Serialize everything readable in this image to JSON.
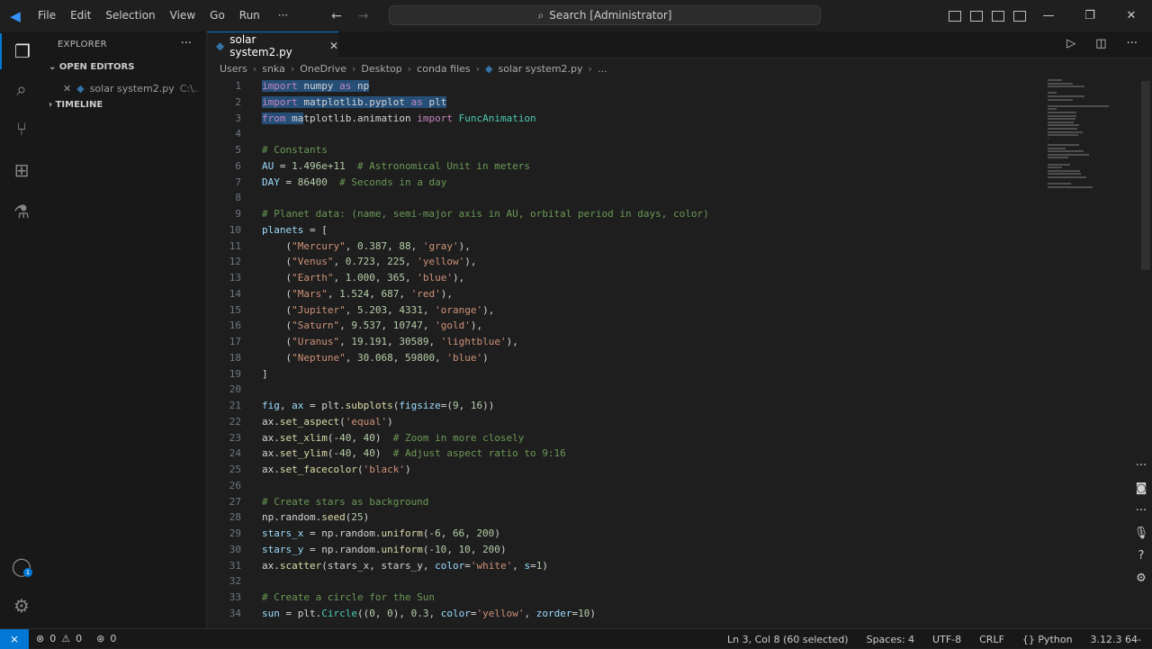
{
  "menu": [
    "File",
    "Edit",
    "Selection",
    "View",
    "Go",
    "Run"
  ],
  "menu_more": "···",
  "search": {
    "text": "Search [Administrator]"
  },
  "explorer": {
    "title": "EXPLORER",
    "more": "···",
    "open_editors": "OPEN EDITORS",
    "open_file": "solar system2.py",
    "open_file_path": "C:\\...",
    "timeline": "TIMELINE"
  },
  "tab": {
    "label": "solar system2.py"
  },
  "breadcrumb": [
    "Users",
    "snka",
    "OneDrive",
    "Desktop",
    "conda files",
    "solar system2.py",
    "..."
  ],
  "code_lines": [
    {
      "n": "1",
      "parts": [
        [
          "kw sel",
          "import"
        ],
        [
          "pl sel",
          " numpy "
        ],
        [
          "kw sel",
          "as"
        ],
        [
          "pl sel",
          " np"
        ]
      ]
    },
    {
      "n": "2",
      "parts": [
        [
          "kw sel",
          "import"
        ],
        [
          "pl sel",
          " matplotlib.pyplot "
        ],
        [
          "kw sel",
          "as"
        ],
        [
          "pl sel",
          " plt"
        ]
      ]
    },
    {
      "n": "3",
      "parts": [
        [
          "kw sel",
          "from"
        ],
        [
          "pl sel",
          " ma"
        ],
        [
          "pl",
          "tplotlib.animation "
        ],
        [
          "kw",
          "import"
        ],
        [
          "cl",
          " FuncAnimation"
        ]
      ]
    },
    {
      "n": "4",
      "parts": []
    },
    {
      "n": "5",
      "parts": [
        [
          "cm",
          "# Constants"
        ]
      ]
    },
    {
      "n": "6",
      "parts": [
        [
          "vr",
          "AU"
        ],
        [
          "pl",
          " = "
        ],
        [
          "nu",
          "1.496e+11"
        ],
        [
          "cm",
          "  # Astronomical Unit in meters"
        ]
      ]
    },
    {
      "n": "7",
      "parts": [
        [
          "vr",
          "DAY"
        ],
        [
          "pl",
          " = "
        ],
        [
          "nu",
          "86400"
        ],
        [
          "cm",
          "  # Seconds in a day"
        ]
      ]
    },
    {
      "n": "8",
      "parts": []
    },
    {
      "n": "9",
      "parts": [
        [
          "cm",
          "# Planet data: (name, semi-major axis in AU, orbital period in days, color)"
        ]
      ]
    },
    {
      "n": "10",
      "parts": [
        [
          "vr",
          "planets"
        ],
        [
          "pl",
          " = ["
        ]
      ]
    },
    {
      "n": "11",
      "parts": [
        [
          "pl",
          "    ("
        ],
        [
          "st",
          "\"Mercury\""
        ],
        [
          "pl",
          ", "
        ],
        [
          "nu",
          "0.387"
        ],
        [
          "pl",
          ", "
        ],
        [
          "nu",
          "88"
        ],
        [
          "pl",
          ", "
        ],
        [
          "st",
          "'gray'"
        ],
        [
          "pl",
          "),"
        ]
      ]
    },
    {
      "n": "12",
      "parts": [
        [
          "pl",
          "    ("
        ],
        [
          "st",
          "\"Venus\""
        ],
        [
          "pl",
          ", "
        ],
        [
          "nu",
          "0.723"
        ],
        [
          "pl",
          ", "
        ],
        [
          "nu",
          "225"
        ],
        [
          "pl",
          ", "
        ],
        [
          "st",
          "'yellow'"
        ],
        [
          "pl",
          "),"
        ]
      ]
    },
    {
      "n": "13",
      "parts": [
        [
          "pl",
          "    ("
        ],
        [
          "st",
          "\"Earth\""
        ],
        [
          "pl",
          ", "
        ],
        [
          "nu",
          "1.000"
        ],
        [
          "pl",
          ", "
        ],
        [
          "nu",
          "365"
        ],
        [
          "pl",
          ", "
        ],
        [
          "st",
          "'blue'"
        ],
        [
          "pl",
          "),"
        ]
      ]
    },
    {
      "n": "14",
      "parts": [
        [
          "pl",
          "    ("
        ],
        [
          "st",
          "\"Mars\""
        ],
        [
          "pl",
          ", "
        ],
        [
          "nu",
          "1.524"
        ],
        [
          "pl",
          ", "
        ],
        [
          "nu",
          "687"
        ],
        [
          "pl",
          ", "
        ],
        [
          "st",
          "'red'"
        ],
        [
          "pl",
          "),"
        ]
      ]
    },
    {
      "n": "15",
      "parts": [
        [
          "pl",
          "    ("
        ],
        [
          "st",
          "\"Jupiter\""
        ],
        [
          "pl",
          ", "
        ],
        [
          "nu",
          "5.203"
        ],
        [
          "pl",
          ", "
        ],
        [
          "nu",
          "4331"
        ],
        [
          "pl",
          ", "
        ],
        [
          "st",
          "'orange'"
        ],
        [
          "pl",
          "),"
        ]
      ]
    },
    {
      "n": "16",
      "parts": [
        [
          "pl",
          "    ("
        ],
        [
          "st",
          "\"Saturn\""
        ],
        [
          "pl",
          ", "
        ],
        [
          "nu",
          "9.537"
        ],
        [
          "pl",
          ", "
        ],
        [
          "nu",
          "10747"
        ],
        [
          "pl",
          ", "
        ],
        [
          "st",
          "'gold'"
        ],
        [
          "pl",
          "),"
        ]
      ]
    },
    {
      "n": "17",
      "parts": [
        [
          "pl",
          "    ("
        ],
        [
          "st",
          "\"Uranus\""
        ],
        [
          "pl",
          ", "
        ],
        [
          "nu",
          "19.191"
        ],
        [
          "pl",
          ", "
        ],
        [
          "nu",
          "30589"
        ],
        [
          "pl",
          ", "
        ],
        [
          "st",
          "'lightblue'"
        ],
        [
          "pl",
          "),"
        ]
      ]
    },
    {
      "n": "18",
      "parts": [
        [
          "pl",
          "    ("
        ],
        [
          "st",
          "\"Neptune\""
        ],
        [
          "pl",
          ", "
        ],
        [
          "nu",
          "30.068"
        ],
        [
          "pl",
          ", "
        ],
        [
          "nu",
          "59800"
        ],
        [
          "pl",
          ", "
        ],
        [
          "st",
          "'blue'"
        ],
        [
          "pl",
          ")"
        ]
      ]
    },
    {
      "n": "19",
      "parts": [
        [
          "pl",
          "]"
        ]
      ]
    },
    {
      "n": "20",
      "parts": []
    },
    {
      "n": "21",
      "parts": [
        [
          "vr",
          "fig"
        ],
        [
          "pl",
          ", "
        ],
        [
          "vr",
          "ax"
        ],
        [
          "pl",
          " = plt."
        ],
        [
          "fn",
          "subplots"
        ],
        [
          "pl",
          "("
        ],
        [
          "vr",
          "figsize"
        ],
        [
          "pl",
          "=("
        ],
        [
          "nu",
          "9"
        ],
        [
          "pl",
          ", "
        ],
        [
          "nu",
          "16"
        ],
        [
          "pl",
          "))"
        ]
      ]
    },
    {
      "n": "22",
      "parts": [
        [
          "pl",
          "ax."
        ],
        [
          "fn",
          "set_aspect"
        ],
        [
          "pl",
          "("
        ],
        [
          "st",
          "'equal'"
        ],
        [
          "pl",
          ")"
        ]
      ]
    },
    {
      "n": "23",
      "parts": [
        [
          "pl",
          "ax."
        ],
        [
          "fn",
          "set_xlim"
        ],
        [
          "pl",
          "(-"
        ],
        [
          "nu",
          "40"
        ],
        [
          "pl",
          ", "
        ],
        [
          "nu",
          "40"
        ],
        [
          "pl",
          ")"
        ],
        [
          "cm",
          "  # Zoom in more closely"
        ]
      ]
    },
    {
      "n": "24",
      "parts": [
        [
          "pl",
          "ax."
        ],
        [
          "fn",
          "set_ylim"
        ],
        [
          "pl",
          "(-"
        ],
        [
          "nu",
          "40"
        ],
        [
          "pl",
          ", "
        ],
        [
          "nu",
          "40"
        ],
        [
          "pl",
          ")"
        ],
        [
          "cm",
          "  # Adjust aspect ratio to 9:16"
        ]
      ]
    },
    {
      "n": "25",
      "parts": [
        [
          "pl",
          "ax."
        ],
        [
          "fn",
          "set_facecolor"
        ],
        [
          "pl",
          "("
        ],
        [
          "st",
          "'black'"
        ],
        [
          "pl",
          ")"
        ]
      ]
    },
    {
      "n": "26",
      "parts": []
    },
    {
      "n": "27",
      "parts": [
        [
          "cm",
          "# Create stars as background"
        ]
      ]
    },
    {
      "n": "28",
      "parts": [
        [
          "pl",
          "np.random."
        ],
        [
          "fn",
          "seed"
        ],
        [
          "pl",
          "("
        ],
        [
          "nu",
          "25"
        ],
        [
          "pl",
          ")"
        ]
      ]
    },
    {
      "n": "29",
      "parts": [
        [
          "vr",
          "stars_x"
        ],
        [
          "pl",
          " = np.random."
        ],
        [
          "fn",
          "uniform"
        ],
        [
          "pl",
          "(-"
        ],
        [
          "nu",
          "6"
        ],
        [
          "pl",
          ", "
        ],
        [
          "nu",
          "66"
        ],
        [
          "pl",
          ", "
        ],
        [
          "nu",
          "200"
        ],
        [
          "pl",
          ")"
        ]
      ]
    },
    {
      "n": "30",
      "parts": [
        [
          "vr",
          "stars_y"
        ],
        [
          "pl",
          " = np.random."
        ],
        [
          "fn",
          "uniform"
        ],
        [
          "pl",
          "(-"
        ],
        [
          "nu",
          "10"
        ],
        [
          "pl",
          ", "
        ],
        [
          "nu",
          "10"
        ],
        [
          "pl",
          ", "
        ],
        [
          "nu",
          "200"
        ],
        [
          "pl",
          ")"
        ]
      ]
    },
    {
      "n": "31",
      "parts": [
        [
          "pl",
          "ax."
        ],
        [
          "fn",
          "scatter"
        ],
        [
          "pl",
          "(stars_x, stars_y, "
        ],
        [
          "vr",
          "color"
        ],
        [
          "pl",
          "="
        ],
        [
          "st",
          "'white'"
        ],
        [
          "pl",
          ", "
        ],
        [
          "vr",
          "s"
        ],
        [
          "pl",
          "="
        ],
        [
          "nu",
          "1"
        ],
        [
          "pl",
          ")"
        ]
      ]
    },
    {
      "n": "32",
      "parts": []
    },
    {
      "n": "33",
      "parts": [
        [
          "cm",
          "# Create a circle for the Sun"
        ]
      ]
    },
    {
      "n": "34",
      "parts": [
        [
          "vr",
          "sun"
        ],
        [
          "pl",
          " = plt."
        ],
        [
          "cl",
          "Circle"
        ],
        [
          "pl",
          "(("
        ],
        [
          "nu",
          "0"
        ],
        [
          "pl",
          ", "
        ],
        [
          "nu",
          "0"
        ],
        [
          "pl",
          "), "
        ],
        [
          "nu",
          "0.3"
        ],
        [
          "pl",
          ", "
        ],
        [
          "vr",
          "color"
        ],
        [
          "pl",
          "="
        ],
        [
          "st",
          "'yellow'"
        ],
        [
          "pl",
          ", "
        ],
        [
          "vr",
          "zorder"
        ],
        [
          "pl",
          "="
        ],
        [
          "nu",
          "10"
        ],
        [
          "pl",
          ")"
        ]
      ]
    }
  ],
  "status": {
    "errors": "0",
    "warnings": "0",
    "ports": "0",
    "position": "Ln 3, Col 8 (60 selected)",
    "spaces": "Spaces: 4",
    "encoding": "UTF-8",
    "eol": "CRLF",
    "language": "Python",
    "interpreter": "3.12.3 64-"
  },
  "colors": {
    "accent": "#0078d4",
    "selection": "#264f78"
  }
}
